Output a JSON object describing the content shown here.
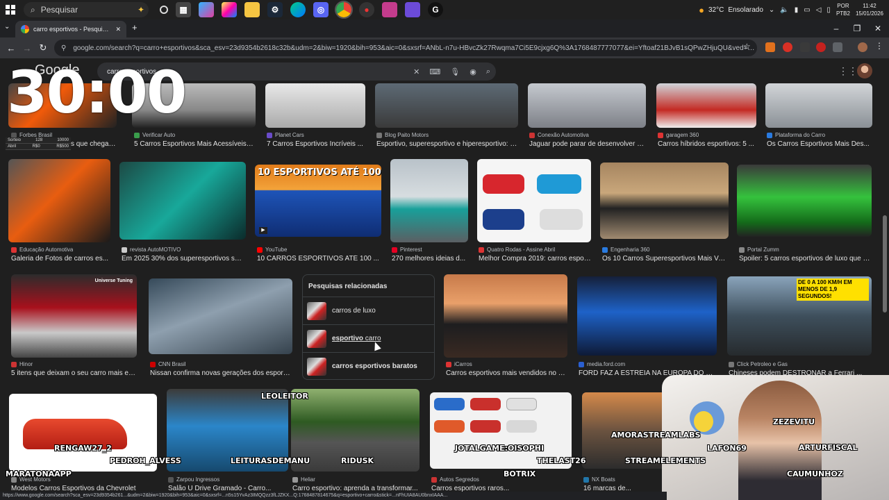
{
  "taskbar": {
    "search_placeholder": "Pesquisar",
    "weather_temp": "32°C",
    "weather_text": "Ensolarado",
    "lang_top": "POR",
    "lang_bottom": "PTB2",
    "time": "11:42",
    "date": "15/01/2026"
  },
  "browser": {
    "tab_title": "carro esportivos - Pesquisa Goo",
    "url": "google.com/search?q=carro+esportivos&sca_esv=23d9354b2618c32b&udm=2&biw=1920&bih=953&aic=0&sxsrf=ANbL-n7u-HBvcZk27Rwqma7Ci5E9cjxg6Q%3A1768487777077&ei=Yftoaf21BJvB1sQPwZHjuQU&ved=0ahUKEwi9..."
  },
  "google": {
    "logo": "Google",
    "query": "carro esportivos"
  },
  "overlay": {
    "timer": "30:00",
    "bet_rows": [
      {
        "a": "Sorteio",
        "b": "128",
        "c": "10000"
      },
      {
        "a": "Abril",
        "b": "R$0",
        "c": "R$500"
      }
    ]
  },
  "row1": [
    {
      "source": "Forbes Brasil",
      "caption": "s que chegam ..."
    },
    {
      "source": "Verificar Auto",
      "caption": "5 Carros Esportivos Mais Acessíveis n..."
    },
    {
      "source": "Planet Cars",
      "caption": "7 Carros Esportivos Incríveis ..."
    },
    {
      "source": "Blog Paito Motors",
      "caption": "Esportivo, superesportivo e hiperesportivo: e..."
    },
    {
      "source": "Conexão Automotiva",
      "caption": "Jaguar pode parar de desenvolver c..."
    },
    {
      "source": "garagem 360",
      "caption": "Carros híbridos esportivos: 5 ..."
    },
    {
      "source": "Plataforma do Carro",
      "caption": "Os Carros Esportivos Mais Des..."
    }
  ],
  "row2": [
    {
      "source": "Educação Automotiva",
      "caption": "Galeria de Fotos de carros es..."
    },
    {
      "source": "revista AutoMOTIVO",
      "caption": "Em 2025 30% dos superesportivos ser..."
    },
    {
      "source": "YouTube",
      "caption": "10 CARROS ESPORTIVOS ATÉ 100 ...",
      "thumb_text": "10 ESPORTIVOS ATÉ 100 K"
    },
    {
      "source": "Pinterest",
      "caption": "270 melhores ideias d..."
    },
    {
      "source": "Quatro Rodas - Assine Abril",
      "caption": "Melhor Compra 2019: carros espor..."
    },
    {
      "source": "Engenharia 360",
      "caption": "Os 10 Carros Superesportivos Mais Vel..."
    },
    {
      "source": "Portal Zumm",
      "caption": "Spoiler: 5 carros esportivos de luxo que s..."
    }
  ],
  "row3": [
    {
      "source": "Hinor",
      "caption": "5 itens que deixam o seu carro mais es..."
    },
    {
      "source": "CNN Brasil",
      "caption": "Nissan confirma novas gerações dos esportiv..."
    },
    {
      "source": "iCarros",
      "caption": "Carros esportivos mais vendidos no B..."
    },
    {
      "source": "media.ford.com",
      "caption": "FORD FAZ A ESTREIA NA EUROPA DO ES..."
    },
    {
      "source": "Click Petroleo e Gas",
      "caption": "Chineses podem DESTRONAR a Ferrari ..."
    }
  ],
  "row3_thumb_text": {
    "universe": "Universe Tuning",
    "speed": "DE 0 A 100 KM/H EM MENOS DE 1,9 SEGUNDOS!"
  },
  "related": {
    "heading": "Pesquisas relacionadas",
    "items": [
      {
        "bold": "",
        "text": "carros de luxo"
      },
      {
        "bold": "esportivo",
        "text": " carro"
      },
      {
        "bold": "carros",
        "text": " esportivos baratos"
      }
    ]
  },
  "row4": [
    {
      "source": "West Motors",
      "caption": "Modelos Carros Esportivos da Chevrolet"
    },
    {
      "source": "Zarpou Ingressos",
      "caption": "Salão U Drive Gramado - Carro..."
    },
    {
      "source": "Heliar",
      "caption": "Carro esportivo: aprenda a transformar..."
    },
    {
      "source": "Autos Segredos",
      "caption": "Carros esportivos raros..."
    },
    {
      "source": "NX Boats",
      "caption": "16 marcas de..."
    }
  ],
  "chat_names": [
    "LEOLEITOR",
    "RENGAW27_2",
    "PEDROH_ALVESS",
    "LEITURASDEMANU",
    "RIDUSK",
    "MARATONAAPP",
    "JOTALGAME:OISOPHI",
    "THELAST26",
    "AMORASTREAMLABS",
    "STREAMELEMENTS",
    "BOTRIX",
    "ZEZEVITU",
    "LAFON69",
    "ARTURFISCAL",
    "CAUMUNHOZ"
  ],
  "statusbar": "https://www.google.com/search?sca_esv=23d9354b261...&udm=2&biw=1920&bih=953&aic=0&sxsrf=...n5s15YvAz3IMQQzz3fLJZKX...Q:1768487814675&q=esportivo+carro&stick=...nFhUIA8AU0bnxIAAA..."
}
